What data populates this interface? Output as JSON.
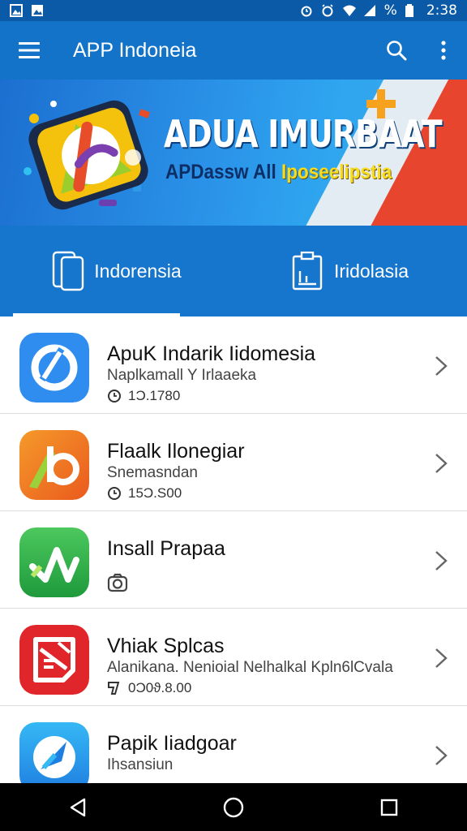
{
  "status_bar": {
    "time": "2:38",
    "battery_text": "%"
  },
  "app_bar": {
    "title": "APP Indoneia"
  },
  "banner": {
    "headline": "ADUA IMURBAAT",
    "subline_part1": "APDassw All ",
    "subline_part2": "Iposeelipstia"
  },
  "tabs": [
    {
      "label": "Indorensia"
    },
    {
      "label": "Iridolasia"
    }
  ],
  "apps": [
    {
      "name": "ApuK Indarik Iidomesia",
      "subtitle": "Naplkamall Y Irlaaeka",
      "meta": "1Ɔ.1780",
      "icon_color": "#2f8df0"
    },
    {
      "name": "Flaalk Ilonegiar",
      "subtitle": "Snemasndan",
      "meta": "15Ɔ.S00",
      "icon_color": "#f07a22"
    },
    {
      "name": "Insall Prapaa",
      "subtitle": "",
      "meta": "",
      "icon_color": "#2db34a"
    },
    {
      "name": "Vhiak Splcas",
      "subtitle": "Alanikana. Nenioial Nelhalkal Kpln6lCvala",
      "meta": "0Ɔ0ϑ.8.00",
      "icon_color": "#e0262b"
    },
    {
      "name": "Papik Iiadgoar",
      "subtitle": "Ihsansiun",
      "meta": "",
      "icon_color": "#2d9cf0"
    }
  ]
}
